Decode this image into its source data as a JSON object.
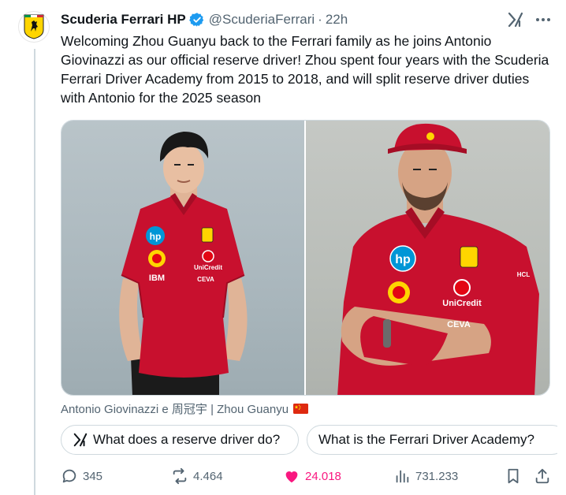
{
  "tweet": {
    "display_name": "Scuderia Ferrari HP",
    "handle": "@ScuderiaFerrari",
    "separator": "·",
    "time": "22h",
    "text": "Welcoming Zhou Guanyu back to the Ferrari family as he joins Antonio Giovinazzi as our official reserve driver! Zhou spent four years with the Scuderia Ferrari Driver Academy from 2015 to 2018, and will split reserve driver duties with Antonio for the 2025 season",
    "caption": "Antonio Giovinazzi e 周冠宇 | Zhou Guanyu",
    "caption_flag": "china-flag-icon"
  },
  "media": {
    "left_photo": {
      "subject": "Zhou Guanyu",
      "shirt_logos": [
        "hp",
        "IBM",
        "UniCredit",
        "CEVA"
      ]
    },
    "right_photo": {
      "subject": "Antonio Giovinazzi",
      "shirt_logos": [
        "hp",
        "UniCredit",
        "CEVA",
        "HCL"
      ]
    }
  },
  "grok_prompts": [
    {
      "label": "What does a reserve driver do?",
      "icon": "grok-icon"
    },
    {
      "label": "What is the Ferrari Driver Academy?",
      "icon": "grok-icon"
    }
  ],
  "actions": {
    "replies": "345",
    "reposts": "4.464",
    "likes": "24.018",
    "views": "731.233"
  },
  "colors": {
    "ferrari_red": "#c8102e",
    "like_pink": "#f91880",
    "verified_blue": "#1d9bf0",
    "muted_text": "#536471"
  }
}
